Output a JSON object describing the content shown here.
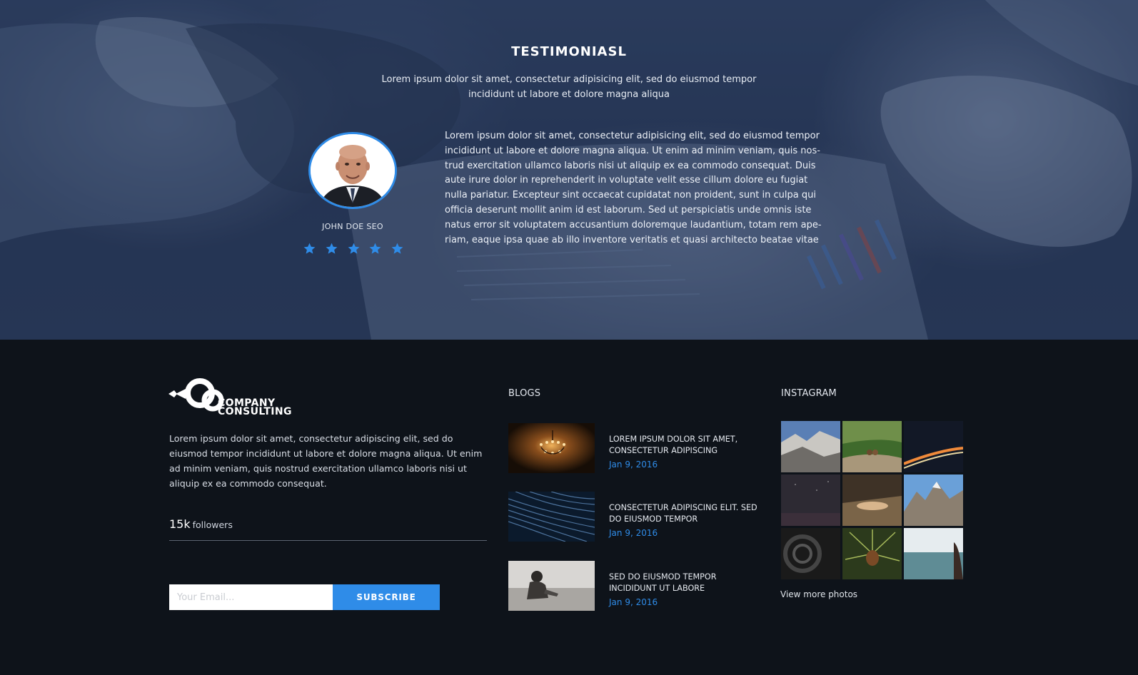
{
  "testimonials": {
    "title": "TESTIMONIASL",
    "subtitle": "Lorem ipsum dolor sit amet, consectetur adipisicing elit, sed do eiusmod tempor incididunt ut labore et dolore magna aliqua",
    "person_name": "JOHN DOE SEO",
    "rating": 5,
    "quote": "Lorem ipsum dolor sit amet, consectetur adipisicing elit, sed do eiusmod tempor incididunt ut labore et dolore magna aliqua. Ut enim ad minim veniam, quis nos-trud exercitation ullamco laboris nisi ut aliquip ex ea commodo consequat. Duis aute irure dolor in reprehenderit in voluptate velit esse cillum dolore eu fugiat nulla pariatur. Excepteur sint occaecat cupidatat non proident, sunt in culpa qui officia deserunt mollit anim id est laborum. Sed ut perspiciatis unde omnis iste natus error sit voluptatem accusantium doloremque laudantium, totam rem ape-riam, eaque ipsa quae ab illo inventore veritatis et quasi architecto beatae vitae",
    "accent_color": "#2f8ce8"
  },
  "footer": {
    "logo_line1": "COMPANY",
    "logo_line2": "CONSULTING",
    "about": "Lorem ipsum dolor sit amet, consectetur adipiscing elit, sed do eiusmod tempor incididunt ut labore et dolore magna aliqua. Ut enim ad minim veniam, quis nostrud exercitation ullamco laboris nisi ut aliquip ex ea commodo consequat.",
    "followers_count": "15k",
    "followers_label": "followers",
    "email_placeholder": "Your Email...",
    "subscribe_label": "SUBSCRIBE",
    "blogs": {
      "title": "BLOGS",
      "items": [
        {
          "title": "LOREM IPSUM DOLOR SIT AMET, CONSECTETUR ADIPISCING",
          "date": "Jan 9, 2016",
          "thumb": "chandelier"
        },
        {
          "title": "CONSECTETUR ADIPISCING ELIT. SED DO EIUSMOD TEMPOR",
          "date": "Jan 9, 2016",
          "thumb": "star-trails"
        },
        {
          "title": "SED DO EIUSMOD TEMPOR INCIDIDUNT UT LABORE",
          "date": "Jan 9, 2016",
          "thumb": "child-playing"
        }
      ]
    },
    "instagram": {
      "title": "INSTAGRAM",
      "photos": [
        "mountain-rocks",
        "forest-couple",
        "night-road",
        "night-sky",
        "lying-person",
        "snowy-peaks",
        "dark-tunnel",
        "pine-cone",
        "sea-shore"
      ],
      "view_more": "View more photos"
    }
  },
  "colors": {
    "footer_bg": "#0e131a",
    "accent": "#2f8ce8"
  }
}
